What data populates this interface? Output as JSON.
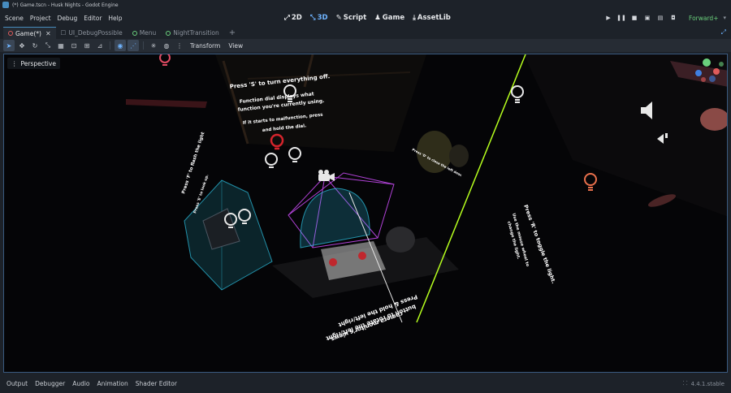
{
  "window": {
    "title": "(*) Game.tscn - Husk Nights - Godot Engine"
  },
  "menu": {
    "items": [
      "Scene",
      "Project",
      "Debug",
      "Editor",
      "Help"
    ]
  },
  "workspaces": {
    "w2d": "2D",
    "w3d": "3D",
    "script": "Script",
    "game": "Game",
    "assetlib": "AssetLib"
  },
  "renderer": "Forward+",
  "tabs": [
    {
      "label": "Game(*)",
      "active": true
    },
    {
      "label": "UI_DebugPossible",
      "active": false
    },
    {
      "label": "Menu",
      "active": false
    },
    {
      "label": "NightTransition",
      "active": false
    }
  ],
  "toolbar": {
    "transform": "Transform",
    "view": "View"
  },
  "viewport": {
    "perspective_label": "Perspective",
    "text_s": "Press 'S' to turn everything off.",
    "text_dial1": "Function dial displays what",
    "text_dial2": "function you're currently using.",
    "text_mal1": "If it starts to malfunction, press",
    "text_mal2": "and hold the dial.",
    "text_cam1": "Press & hold the left/right",
    "text_cam2": "button to rotate the left/right",
    "text_cam3": "camera monitor's views.",
    "text_right1": "Press 'R' to toggle the light.",
    "text_right2": "Use the mouse wheel to",
    "text_right3": "change the light.",
    "text_left1": "Press 'F' to flash the light",
    "text_left2": "Press 'E' to look up.",
    "text_small": "Press 'D' to close the left door."
  },
  "bottom": {
    "items": [
      "Output",
      "Debugger",
      "Audio",
      "Animation",
      "Shader Editor"
    ],
    "version": "4.4.1.stable"
  },
  "colors": {
    "accent": "#478cbf",
    "viewport_bg": "#050507",
    "laser": "#b6ff1e",
    "gizmo_cyan": "#2ec4e6",
    "gizmo_purple": "#b042d6",
    "light_icon": "#e9704c"
  }
}
